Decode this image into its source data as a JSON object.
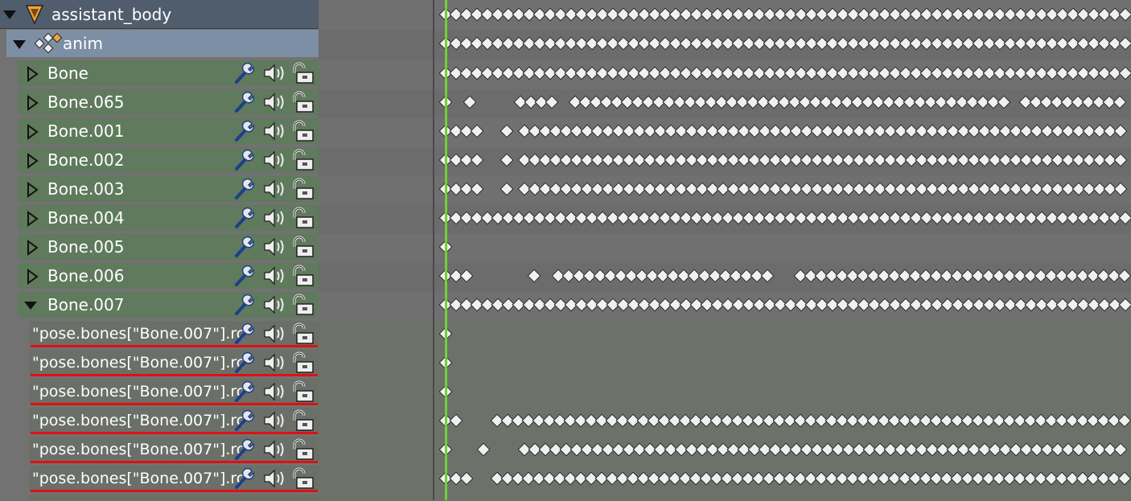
{
  "object": {
    "name": "assistant_body",
    "icon": "armature-object-icon"
  },
  "action": {
    "name": "anim",
    "icon": "action-icon"
  },
  "groups": [
    {
      "name": "Bone",
      "expanded": false
    },
    {
      "name": "Bone.065",
      "expanded": false
    },
    {
      "name": "Bone.001",
      "expanded": false
    },
    {
      "name": "Bone.002",
      "expanded": false
    },
    {
      "name": "Bone.003",
      "expanded": false
    },
    {
      "name": "Bone.004",
      "expanded": false
    },
    {
      "name": "Bone.005",
      "expanded": false
    },
    {
      "name": "Bone.006",
      "expanded": false
    },
    {
      "name": "Bone.007",
      "expanded": true
    }
  ],
  "fcurves": [
    {
      "name": "\"pose.bones[\"Bone.007\"].rc"
    },
    {
      "name": "\"pose.bones[\"Bone.007\"].rc"
    },
    {
      "name": "\"pose.bones[\"Bone.007\"].rc"
    },
    {
      "name": "\"pose.bones[\"Bone.007\"].rc"
    },
    {
      "name": "\"pose.bones[\"Bone.007\"].rc"
    },
    {
      "name": "\"pose.bones[\"Bone.007\"].rc"
    }
  ],
  "channel_icons": [
    "wrench-icon",
    "speaker-icon",
    "unlock-icon"
  ],
  "colors": {
    "object_row": "#4f5d6d",
    "action_row": "#7d8fa4",
    "group_row": "#5f7a5c",
    "fcurve_highlight": "#e01010",
    "playhead": "#6fd13a",
    "keyframe": "#f0f0f0"
  },
  "keyframe_runs": [
    [
      [
        0,
        1
      ]
    ],
    [
      [
        0,
        1
      ]
    ],
    [
      [
        0,
        1
      ]
    ],
    [
      [
        0,
        0.002
      ],
      [
        0.035,
        0.035
      ],
      [
        0.11,
        0.17
      ],
      [
        0.19,
        0.825
      ],
      [
        0.85,
        1
      ]
    ],
    [
      [
        0,
        0.06
      ],
      [
        0.09,
        0.09
      ],
      [
        0.115,
        1
      ]
    ],
    [
      [
        0,
        0.06
      ],
      [
        0.09,
        0.09
      ],
      [
        0.115,
        1
      ]
    ],
    [
      [
        0,
        0.06
      ],
      [
        0.09,
        0.09
      ],
      [
        0.115,
        1
      ]
    ],
    [
      [
        0,
        1
      ]
    ],
    [
      [
        0,
        0
      ]
    ],
    [
      [
        0,
        0.04
      ],
      [
        0.13,
        0.13
      ],
      [
        0.165,
        0.48
      ],
      [
        0.52,
        1
      ]
    ],
    [
      [
        0,
        1
      ]
    ],
    [
      [
        0,
        0
      ]
    ],
    [
      [
        0,
        0
      ]
    ],
    [
      [
        0,
        0
      ]
    ],
    [
      [
        0,
        0.025
      ],
      [
        0.075,
        1
      ]
    ],
    [
      [
        0,
        0
      ],
      [
        0.055,
        0.055
      ],
      [
        0.115,
        1
      ]
    ],
    [
      [
        0,
        0.04
      ],
      [
        0.075,
        1
      ]
    ]
  ]
}
